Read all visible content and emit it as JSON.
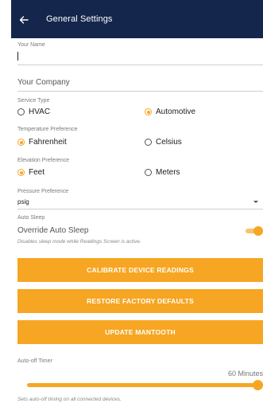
{
  "appbar": {
    "back_icon": "arrow-left-icon",
    "title": "General Settings"
  },
  "your_name": {
    "label": "Your Name",
    "value": ""
  },
  "company": {
    "placeholder": "Your Company"
  },
  "service_type": {
    "label": "Service Type",
    "options": [
      "HVAC",
      "Automotive"
    ],
    "selected": "Automotive"
  },
  "temperature": {
    "label": "Temperature Preference",
    "options": [
      "Fahrenheit",
      "Celsius"
    ],
    "selected": "Fahrenheit"
  },
  "elevation": {
    "label": "Elevation Preference",
    "options": [
      "Feet",
      "Meters"
    ],
    "selected": "Feet"
  },
  "pressure": {
    "label": "Pressure Preference",
    "value": "psig"
  },
  "auto_sleep": {
    "label": "Auto Sleep",
    "title": "Override Auto Sleep",
    "description": "Disables sleep mode while Readings Screen is active.",
    "enabled": true
  },
  "buttons": {
    "calibrate": "CALIBRATE DEVICE READINGS",
    "restore": "RESTORE FACTORY DEFAULTS",
    "update": "UPDATE MANTOOTH"
  },
  "auto_off": {
    "label": "Auto-off Timer",
    "value_label": "60 Minutes",
    "level": 1.0,
    "description": "Sets auto-off timing on all connected devices."
  },
  "colors": {
    "appbar": "#14264c",
    "accent": "#f6a623"
  }
}
